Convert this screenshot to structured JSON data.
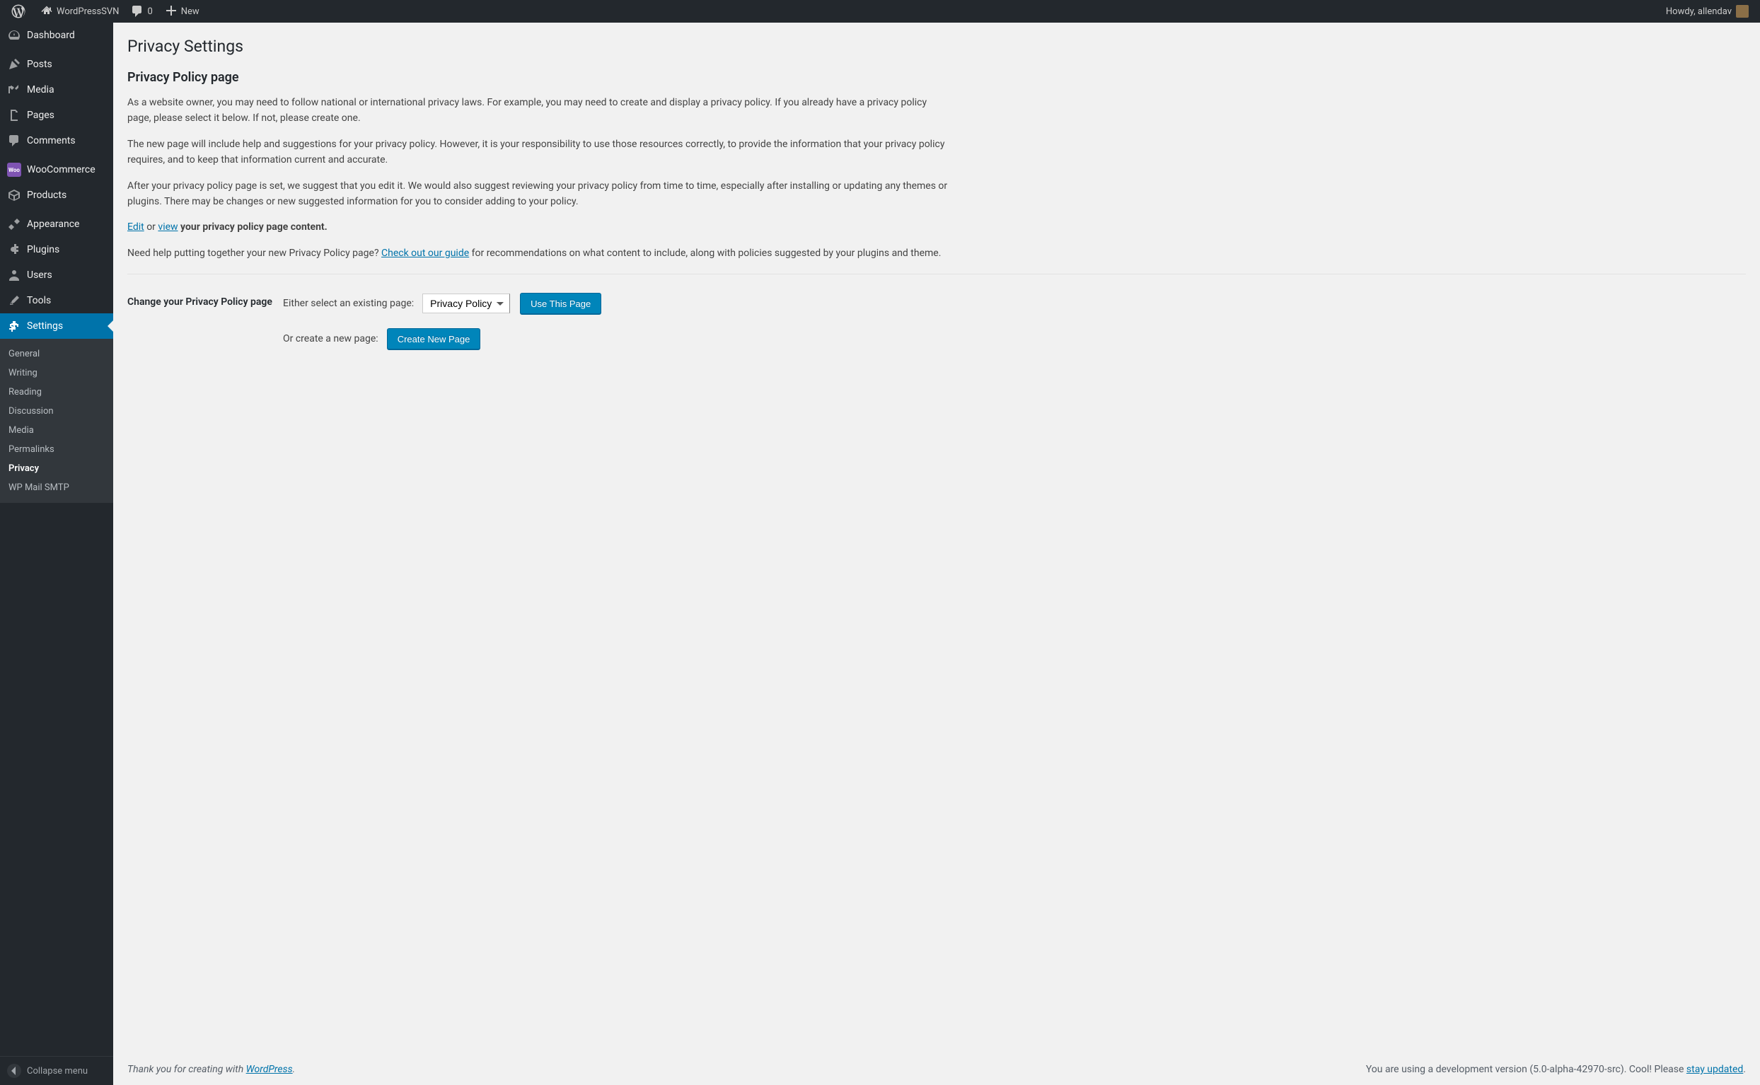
{
  "toolbar": {
    "site_name": "WordPressSVN",
    "comments_count": "0",
    "new_label": "New",
    "howdy_prefix": "Howdy, ",
    "username": "allendav"
  },
  "sidebar": {
    "items": [
      {
        "label": "Dashboard",
        "icon": "dashboard"
      },
      {
        "label": "Posts",
        "icon": "posts"
      },
      {
        "label": "Media",
        "icon": "media"
      },
      {
        "label": "Pages",
        "icon": "pages"
      },
      {
        "label": "Comments",
        "icon": "comments"
      },
      {
        "label": "WooCommerce",
        "icon": "woo"
      },
      {
        "label": "Products",
        "icon": "products"
      },
      {
        "label": "Appearance",
        "icon": "appearance"
      },
      {
        "label": "Plugins",
        "icon": "plugins"
      },
      {
        "label": "Users",
        "icon": "users"
      },
      {
        "label": "Tools",
        "icon": "tools"
      },
      {
        "label": "Settings",
        "icon": "settings",
        "current": true
      }
    ],
    "submenu": [
      {
        "label": "General"
      },
      {
        "label": "Writing"
      },
      {
        "label": "Reading"
      },
      {
        "label": "Discussion"
      },
      {
        "label": "Media"
      },
      {
        "label": "Permalinks"
      },
      {
        "label": "Privacy",
        "current": true
      },
      {
        "label": "WP Mail SMTP"
      }
    ],
    "collapse_label": "Collapse menu"
  },
  "page": {
    "title": "Privacy Settings",
    "subtitle": "Privacy Policy page",
    "p1": "As a website owner, you may need to follow national or international privacy laws. For example, you may need to create and display a privacy policy. If you already have a privacy policy page, please select it below. If not, please create one.",
    "p2": "The new page will include help and suggestions for your privacy policy. However, it is your responsibility to use those resources correctly, to provide the information that your privacy policy requires, and to keep that information current and accurate.",
    "p3": "After your privacy policy page is set, we suggest that you edit it. We would also suggest reviewing your privacy policy from time to time, especially after installing or updating any themes or plugins. There may be changes or new suggested information for you to consider adding to your policy.",
    "edit_link": "Edit",
    "or_text": " or ",
    "view_link": "view",
    "p4_suffix": " your privacy policy page content.",
    "p5_prefix": "Need help putting together your new Privacy Policy page? ",
    "guide_link": "Check out our guide",
    "p5_suffix": " for recommendations on what content to include, along with policies suggested by your plugins and theme.",
    "form_label": "Change your Privacy Policy page",
    "select_label": "Either select an existing page: ",
    "select_value": "Privacy Policy",
    "use_button": "Use This Page",
    "create_label": "Or create a new page: ",
    "create_button": "Create New Page"
  },
  "footer": {
    "thanks_prefix": "Thank you for creating with ",
    "wp_link": "WordPress",
    "thanks_suffix": ".",
    "version_prefix": "You are using a development version (5.0-alpha-42970-src). Cool! Please ",
    "stay_link": "stay updated",
    "version_suffix": "."
  }
}
